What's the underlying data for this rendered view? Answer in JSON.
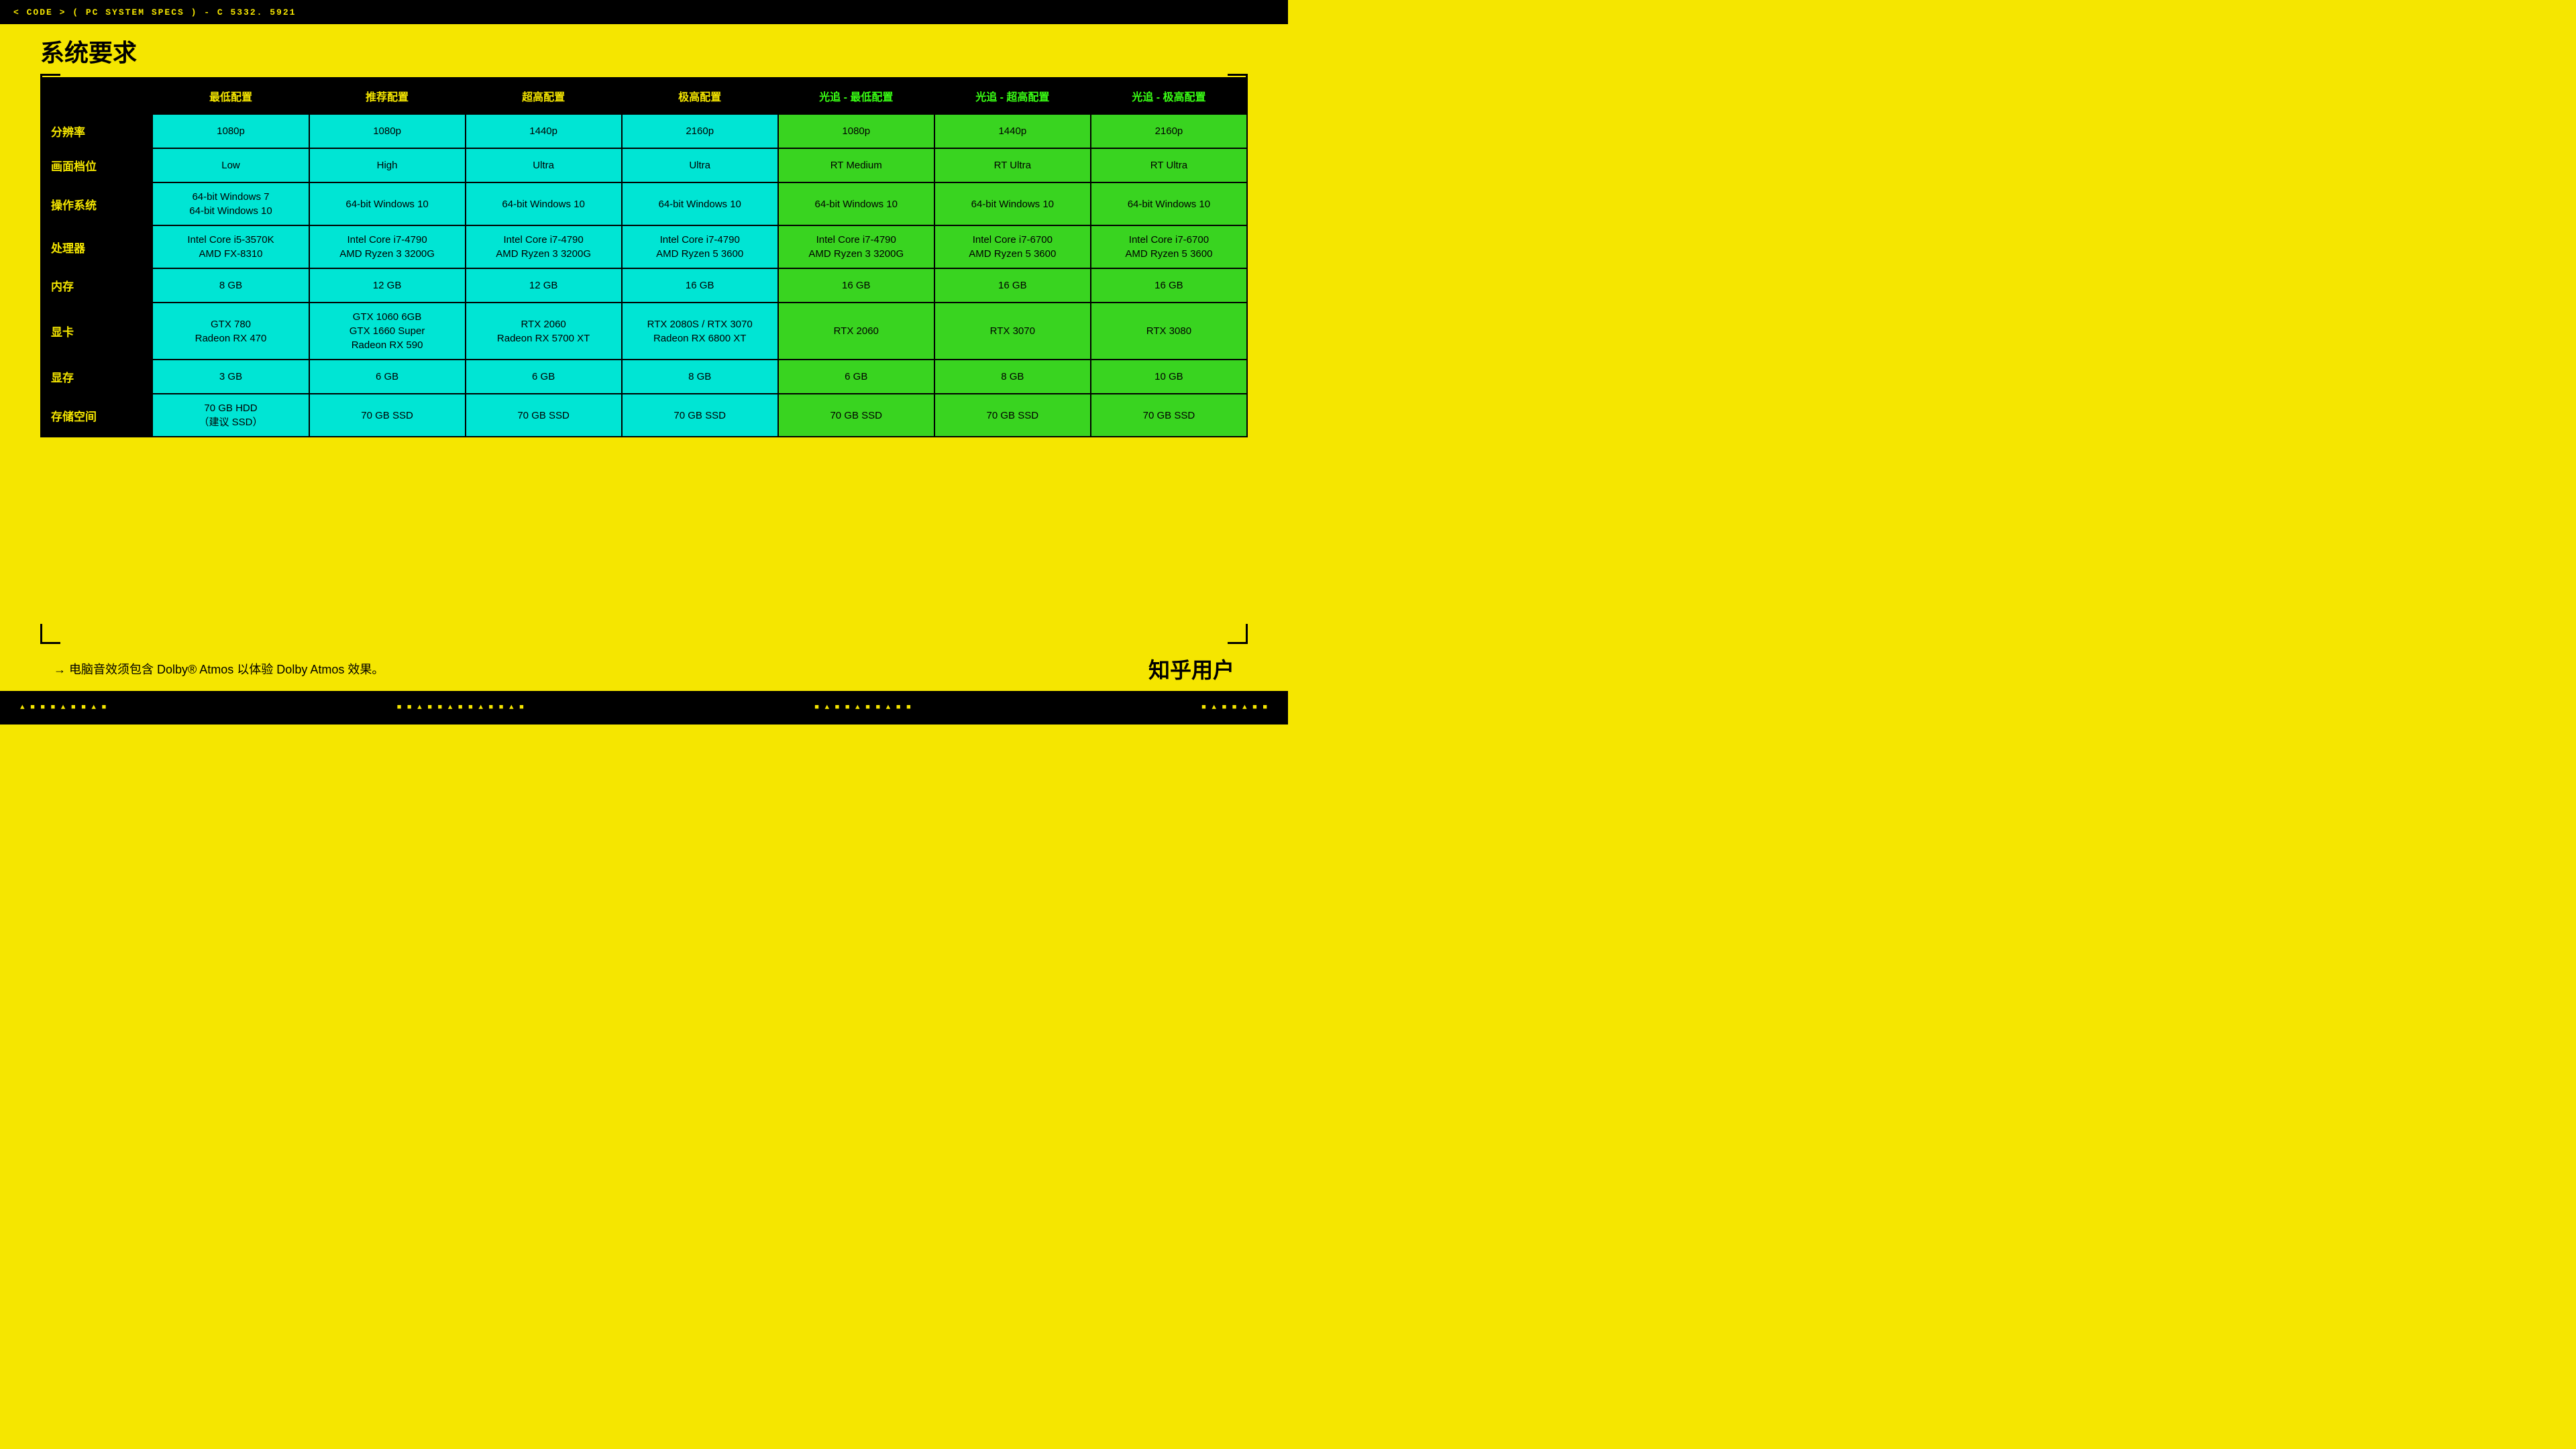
{
  "topbar": {
    "text": "< CODE > ( PC SYSTEM SPECS ) - C 5332. 5921"
  },
  "page": {
    "title": "系统要求"
  },
  "table": {
    "headers": [
      {
        "label": "",
        "type": "label"
      },
      {
        "label": "最低配置",
        "type": "cyan"
      },
      {
        "label": "推荐配置",
        "type": "cyan"
      },
      {
        "label": "超高配置",
        "type": "cyan"
      },
      {
        "label": "极高配置",
        "type": "cyan"
      },
      {
        "label": "光追 - 最低配置",
        "type": "green"
      },
      {
        "label": "光追 - 超高配置",
        "type": "green"
      },
      {
        "label": "光追 - 极高配置",
        "type": "green"
      }
    ],
    "rows": [
      {
        "label": "分辨率",
        "cells": [
          "1080p",
          "1080p",
          "1440p",
          "2160p",
          "1080p",
          "1440p",
          "2160p"
        ]
      },
      {
        "label": "画面档位",
        "cells": [
          "Low",
          "High",
          "Ultra",
          "Ultra",
          "RT Medium",
          "RT Ultra",
          "RT Ultra"
        ]
      },
      {
        "label": "操作系统",
        "cells": [
          "64-bit Windows 7\n64-bit Windows 10",
          "64-bit Windows 10",
          "64-bit Windows 10",
          "64-bit Windows 10",
          "64-bit Windows 10",
          "64-bit Windows 10",
          "64-bit Windows 10"
        ]
      },
      {
        "label": "处理器",
        "cells": [
          "Intel Core i5-3570K\nAMD FX-8310",
          "Intel Core i7-4790\nAMD Ryzen 3 3200G",
          "Intel Core i7-4790\nAMD Ryzen 3 3200G",
          "Intel Core i7-4790\nAMD Ryzen 5 3600",
          "Intel Core i7-4790\nAMD Ryzen 3 3200G",
          "Intel Core i7-6700\nAMD Ryzen 5 3600",
          "Intel Core i7-6700\nAMD Ryzen 5 3600"
        ]
      },
      {
        "label": "内存",
        "cells": [
          "8 GB",
          "12 GB",
          "12 GB",
          "16 GB",
          "16 GB",
          "16 GB",
          "16 GB"
        ]
      },
      {
        "label": "显卡",
        "cells": [
          "GTX 780\nRadeon RX 470",
          "GTX 1060 6GB\nGTX 1660 Super\nRadeon RX 590",
          "RTX 2060\nRadeon RX 5700 XT",
          "RTX 2080S / RTX 3070\nRadeon RX 6800 XT",
          "RTX 2060",
          "RTX 3070",
          "RTX 3080"
        ]
      },
      {
        "label": "显存",
        "cells": [
          "3 GB",
          "6 GB",
          "6 GB",
          "8 GB",
          "6 GB",
          "8 GB",
          "10 GB"
        ]
      },
      {
        "label": "存储空间",
        "cells": [
          "70 GB HDD\n（建议 SSD）",
          "70 GB SSD",
          "70 GB SSD",
          "70 GB SSD",
          "70 GB SSD",
          "70 GB SSD",
          "70 GB SSD"
        ]
      }
    ]
  },
  "footer": {
    "note": "→ 电脑音效须包含 Dolby® Atmos 以体验 Dolby Atmos 效果。"
  },
  "watermark": {
    "text": "知乎用户"
  },
  "bottombar": {
    "left": "▲ ■ ■ ▲ ■",
    "center1": "■ ▲ ■ ■ ▲ ■ ■",
    "center2": "■ ▲ ■ ■ ▲ ■ ■",
    "right": "▲ ■ ■ ▲ ■"
  }
}
